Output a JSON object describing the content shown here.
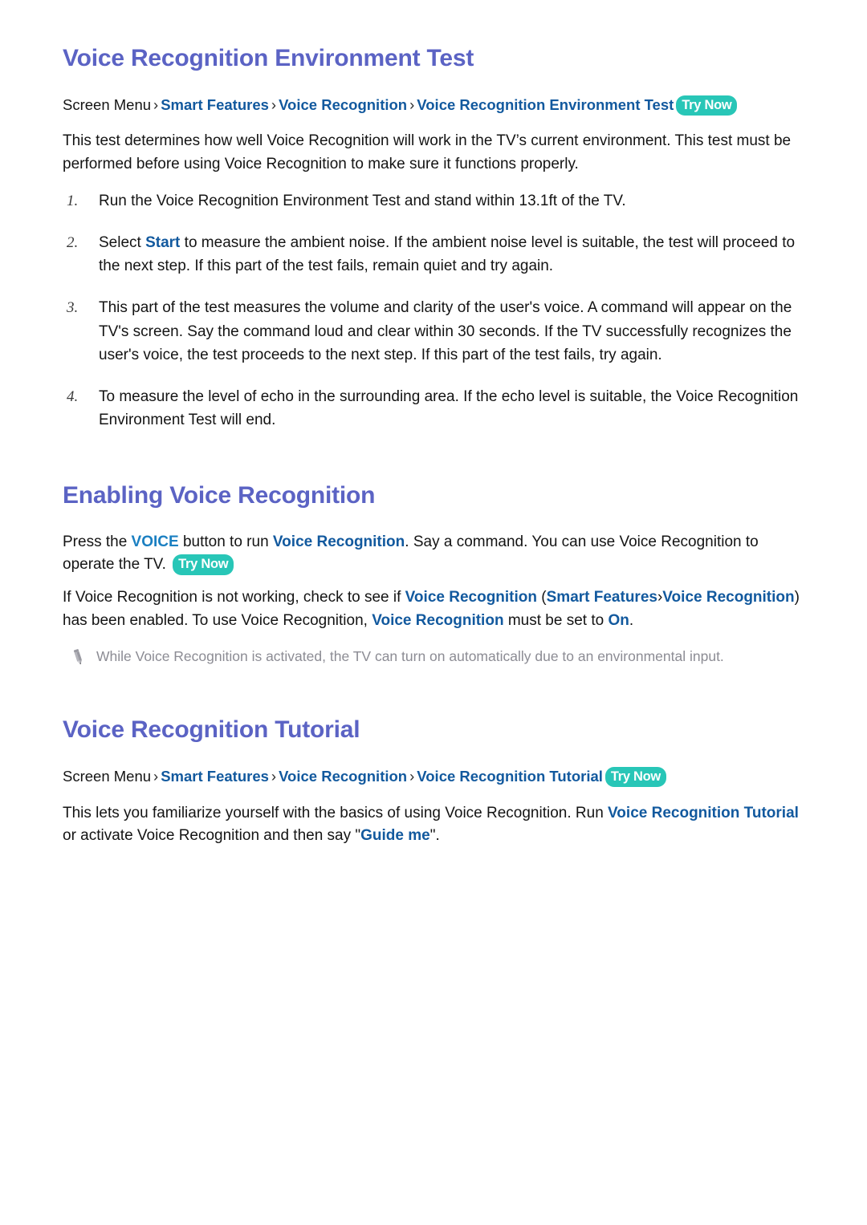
{
  "colors": {
    "heading": "#5b63c4",
    "link": "#12599e",
    "link_light": "#1a7fc1",
    "pill_bg": "#28c6b7",
    "note_text": "#8c8c94",
    "body_text": "#141414"
  },
  "sections": [
    {
      "id": "voice-recognition-environment-test",
      "title": "Voice Recognition Environment Test",
      "breadcrumb": {
        "root": "Screen Menu",
        "separator": "›",
        "links": [
          "Smart Features",
          "Voice Recognition",
          "Voice Recognition Environment Test"
        ],
        "badge": "Try Now"
      },
      "intro": "This test determines how well Voice Recognition will work in the TV’s current environment. This test must be performed before using Voice Recognition to make sure it functions properly.",
      "steps": [
        {
          "number": "1.",
          "text_before": "Run the Voice Recognition Environment Test and stand within 13.1ft of the TV.",
          "link": "",
          "text_after": ""
        },
        {
          "number": "2.",
          "text_before": "Select ",
          "link": "Start",
          "text_after": " to measure the ambient noise. If the ambient noise level is suitable, the test will proceed to the next step. If this part of the test fails, remain quiet and try again."
        },
        {
          "number": "3.",
          "text_before": "This part of the test measures the volume and clarity of the user's voice. A command will appear on the TV's screen. Say the command loud and clear within 30 seconds. If the TV successfully recognizes the user's voice, the test proceeds to the next step. If this part of the test fails, try again.",
          "link": "",
          "text_after": ""
        },
        {
          "number": "4.",
          "text_before": "To measure the level of echo in the surrounding area. If the echo level is suitable, the Voice Recognition Environment Test will end.",
          "link": "",
          "text_after": ""
        }
      ]
    },
    {
      "id": "enabling-voice-recognition",
      "title": "Enabling Voice Recognition",
      "paragraph1": {
        "p1": "Press the ",
        "voice_key": "VOICE",
        "p2": " button to run ",
        "link1": "Voice Recognition",
        "p3": ". Say a command. You can use Voice Recognition to operate the TV. ",
        "badge": "Try Now"
      },
      "paragraph2": {
        "p1": "If Voice Recognition is not working, check to see if ",
        "link1": "Voice Recognition",
        "p2": " (",
        "link2": "Smart Features",
        "sep": "›",
        "link3": "Voice Recognition",
        "p3": ") has been enabled. To use Voice Recognition, ",
        "link4": "Voice Recognition",
        "p4": " must be set to ",
        "link5": "On",
        "p5": "."
      },
      "note": {
        "icon": "pencil-icon",
        "text": "While Voice Recognition is activated, the TV can turn on automatically due to an environmental input."
      }
    },
    {
      "id": "voice-recognition-tutorial",
      "title": "Voice Recognition Tutorial",
      "breadcrumb": {
        "root": "Screen Menu",
        "separator": "›",
        "links": [
          "Smart Features",
          "Voice Recognition",
          "Voice Recognition Tutorial"
        ],
        "badge": "Try Now"
      },
      "paragraph": {
        "p1": "This lets you familiarize yourself with the basics of using Voice Recognition. Run ",
        "link1": "Voice Recognition Tutorial",
        "p2": " or activate Voice Recognition and then say \"",
        "link2": "Guide me",
        "p3": "\"."
      }
    }
  ]
}
